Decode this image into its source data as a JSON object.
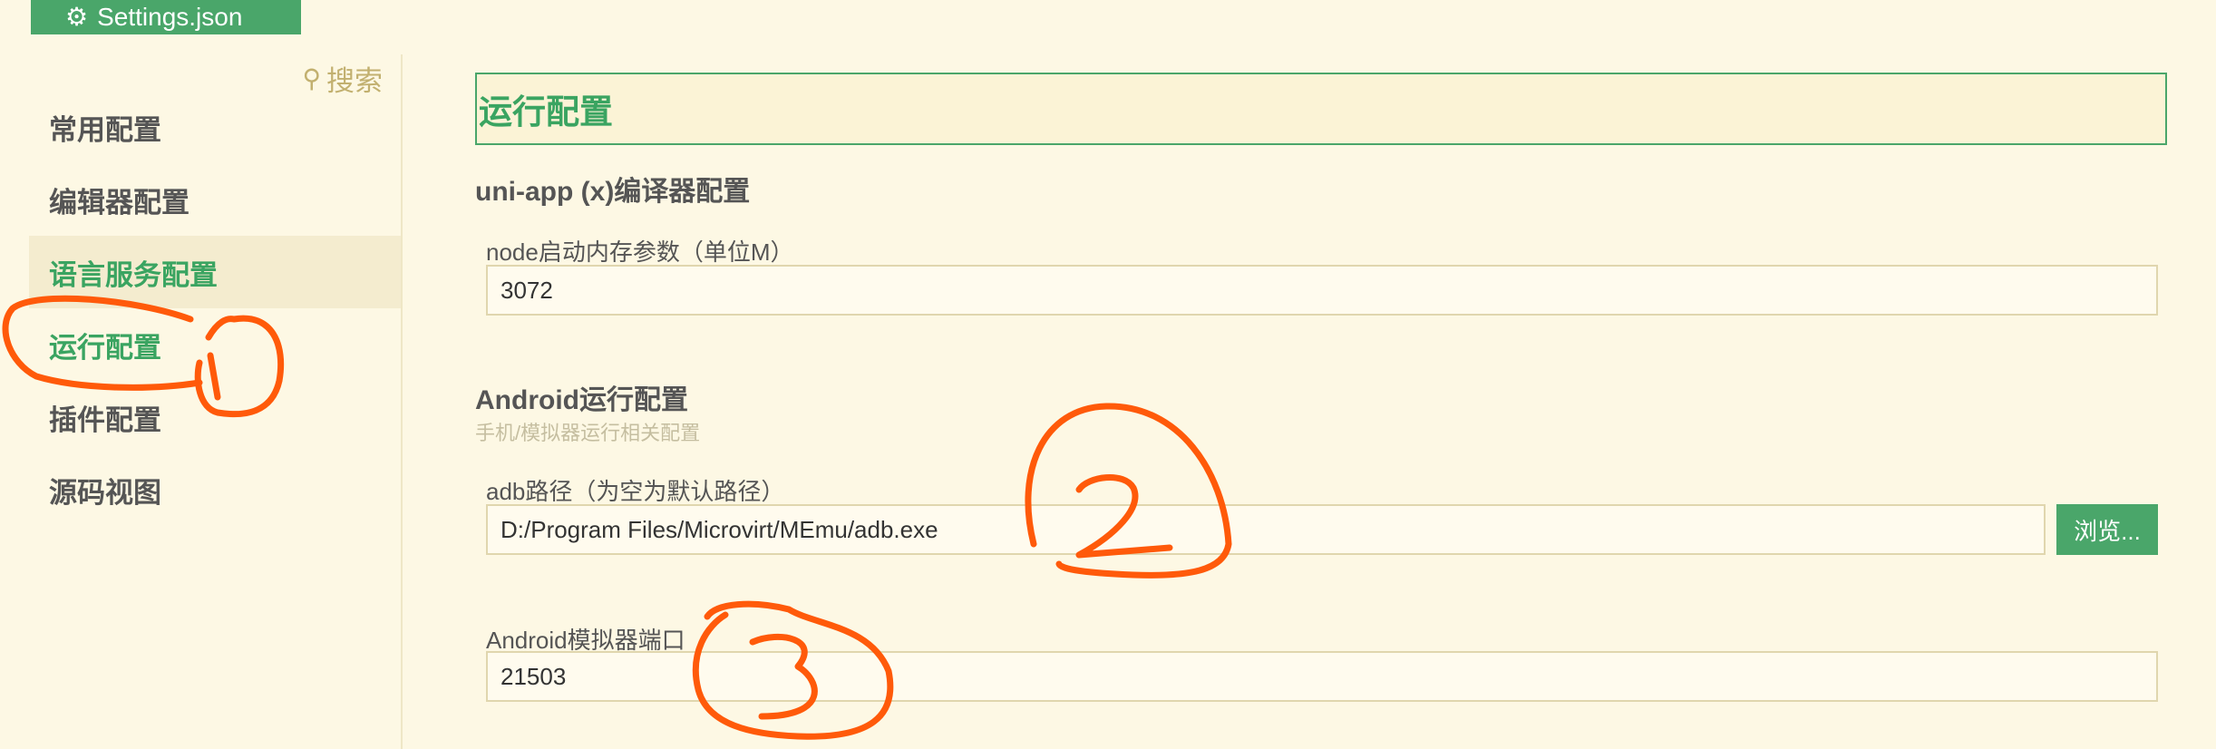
{
  "tab": {
    "title": "Settings.json",
    "icon": "gear-icon"
  },
  "sidebar": {
    "search_label": "搜索",
    "items": [
      {
        "label": "常用配置",
        "state": "normal"
      },
      {
        "label": "编辑器配置",
        "state": "normal"
      },
      {
        "label": "语言服务配置",
        "state": "selected"
      },
      {
        "label": "运行配置",
        "state": "current"
      },
      {
        "label": "插件配置",
        "state": "normal"
      },
      {
        "label": "源码视图",
        "state": "normal"
      }
    ]
  },
  "main": {
    "section_title": "运行配置",
    "groups": [
      {
        "title": "uni-app (x)编译器配置",
        "fields": [
          {
            "label": "node启动内存参数（单位M）",
            "value": "3072"
          }
        ]
      },
      {
        "title": "Android运行配置",
        "subtitle": "手机/模拟器运行相关配置",
        "fields": [
          {
            "label": "adb路径（为空为默认路径）",
            "value": "D:/Program Files/Microvirt/MEmu/adb.exe",
            "button": "浏览..."
          },
          {
            "label": "Android模拟器端口",
            "value": "21503"
          }
        ]
      }
    ]
  },
  "annotations": {
    "color": "#ff5a0a",
    "marks": [
      "1",
      "2",
      "3"
    ]
  },
  "colors": {
    "accent": "#4aa66a",
    "background": "#fdf8e4",
    "selected_bg": "#f4eccf"
  }
}
